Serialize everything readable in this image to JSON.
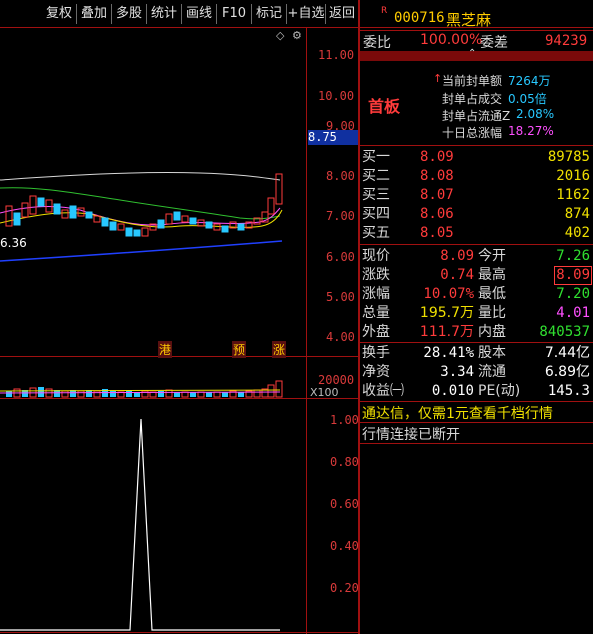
{
  "toolbar": {
    "buttons": [
      "复权",
      "叠加",
      "多股",
      "统计",
      "画线",
      "F10",
      "标记",
      "+自选",
      "返回"
    ]
  },
  "stock": {
    "badge": "R",
    "code": "000716",
    "name": "黑芝麻"
  },
  "weibi": {
    "label1": "委比",
    "value1": "100.00%",
    "label2": "委差",
    "value2": "94239"
  },
  "board": {
    "tag": "首板",
    "seal_amount_label": "当前封单额",
    "seal_amount": "7264万",
    "seal_volume_label": "封单占成交",
    "seal_volume": "0.05倍",
    "seal_float_label": "封单占流通Z",
    "seal_float": "2.08%",
    "ten_day_label": "十日总涨幅",
    "ten_day": "18.27%"
  },
  "bids": [
    {
      "label": "买一",
      "price": "8.09",
      "volume": "89785"
    },
    {
      "label": "买二",
      "price": "8.08",
      "volume": "2016"
    },
    {
      "label": "买三",
      "price": "8.07",
      "volume": "1162"
    },
    {
      "label": "买四",
      "price": "8.06",
      "volume": "874"
    },
    {
      "label": "买五",
      "price": "8.05",
      "volume": "402"
    }
  ],
  "quote": {
    "now_label": "现价",
    "now": "8.09",
    "open_label": "今开",
    "open": "7.26",
    "change_label": "涨跌",
    "change": "0.74",
    "high_label": "最高",
    "high": "8.09",
    "pct_label": "涨幅",
    "pct": "10.07%",
    "low_label": "最低",
    "low": "7.20",
    "vol_label": "总量",
    "vol": "195.7万",
    "vr_label": "量比",
    "vr": "4.01",
    "out_label": "外盘",
    "out": "111.7万",
    "in_label": "内盘",
    "in": "840537",
    "turn_label": "换手",
    "turn": "28.41%",
    "equity_label": "股本",
    "equity": "7.44亿",
    "nav_label": "净资",
    "nav": "3.34",
    "float_label": "流通",
    "float": "6.89亿",
    "eps_label": "收益㈠",
    "eps": "0.010",
    "pe_label": "PE(动)",
    "pe": "145.3"
  },
  "ad_text": "通达信，仅需1元查看千档行情",
  "status_text": "行情连接已断开",
  "price_axis": {
    "ticks": [
      "11.00",
      "10.00",
      "9.00",
      "8.00",
      "7.00",
      "6.00",
      "5.00",
      "4.00"
    ],
    "current": "8.75",
    "low_label": "6.36"
  },
  "markers": [
    "港",
    "预",
    "涨"
  ],
  "volume_axis": {
    "tick": "20000",
    "unit": "X100"
  },
  "indicator_axis": {
    "ticks": [
      "1.00",
      "0.80",
      "0.60",
      "0.40",
      "0.20"
    ]
  },
  "colors": {
    "up": "#ff3b3b",
    "down": "#30e030",
    "bg": "#000000",
    "accent_red": "#a01010"
  }
}
